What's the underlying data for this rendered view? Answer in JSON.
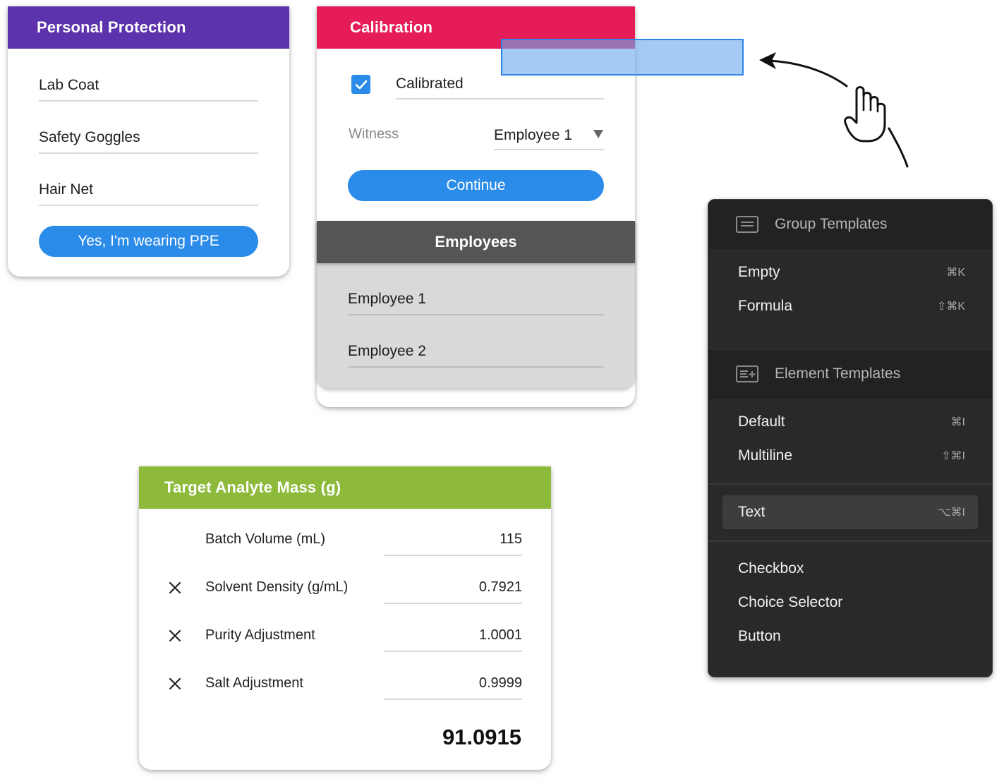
{
  "ppe_card": {
    "title": "Personal Protection",
    "items": [
      "Lab Coat",
      "Safety Goggles",
      "Hair Net"
    ],
    "button_label": "Yes, I'm wearing PPE"
  },
  "calibration_card": {
    "title": "Calibration",
    "checkbox_label": "Calibrated",
    "checked": true,
    "witness_label": "Witness",
    "witness_value": "Employee 1",
    "continue_label": "Continue",
    "employees_title": "Employees",
    "employees": [
      "Employee 1",
      "Employee 2"
    ]
  },
  "analyte_card": {
    "title": "Target Analyte Mass (g)",
    "rows": [
      {
        "label": "Batch Volume (mL)",
        "value": "115",
        "multiply": false
      },
      {
        "label": "Solvent Density (g/mL)",
        "value": "0.7921",
        "multiply": true
      },
      {
        "label": "Purity Adjustment",
        "value": "1.0001",
        "multiply": true
      },
      {
        "label": "Salt Adjustment",
        "value": "0.9999",
        "multiply": true
      }
    ],
    "total": "91.0915"
  },
  "menu": {
    "group_title": "Group Templates",
    "group_items": [
      {
        "label": "Empty",
        "shortcut": "⌘K"
      },
      {
        "label": "Formula",
        "shortcut": "⇧⌘K"
      }
    ],
    "element_title": "Element Templates",
    "element_items": [
      {
        "label": "Default",
        "shortcut": "⌘I"
      },
      {
        "label": "Multiline",
        "shortcut": "⇧⌘I"
      }
    ],
    "highlighted_item": {
      "label": "Text",
      "shortcut": "⌥⌘I"
    },
    "other_items": [
      {
        "label": "Checkbox"
      },
      {
        "label": "Choice Selector"
      },
      {
        "label": "Button"
      }
    ]
  },
  "colors": {
    "ppe_header": "#5c33ac",
    "calibration_header": "#e61c58",
    "employees_header": "#555555",
    "analyte_header": "#8dba3b",
    "primary_button": "#2b8be8",
    "menu_bg": "#292929"
  },
  "icons": [
    "checkmark-icon",
    "dropdown-triangle-icon",
    "multiply-icon",
    "group-template-icon",
    "element-template-icon",
    "grab-hand-icon",
    "curved-arrow-icon"
  ]
}
